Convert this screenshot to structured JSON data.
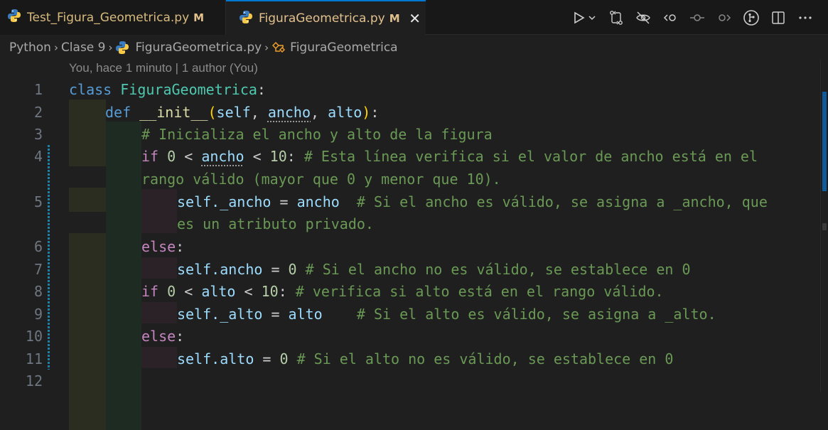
{
  "tabs": [
    {
      "label": "Test_Figura_Geometrica.py",
      "status": "M"
    },
    {
      "label": "FiguraGeometrica.py",
      "status": "M",
      "close": "✕"
    }
  ],
  "breadcrumb": {
    "items": [
      "Python",
      "Clase 9",
      "FiguraGeometrica.py",
      "FiguraGeometrica"
    ],
    "separator": "›"
  },
  "blame": "You, hace 1 minuto | 1 author (You)",
  "line_numbers": [
    "1",
    "2",
    "3",
    "4",
    "",
    "5",
    "",
    "6",
    "7",
    "8",
    "9",
    "10",
    "11",
    "12"
  ],
  "code": {
    "l1": {
      "kw": "class",
      "name": "FiguraGeometrica",
      "colon": ":"
    },
    "l2": {
      "kw": "def",
      "name": "__init__",
      "open": "(",
      "p1": "self",
      "c1": ", ",
      "p2": "ancho",
      "c2": ", ",
      "p3": "alto",
      "close": ")",
      "colon": ":"
    },
    "l3": {
      "comment": "# Inicializa el ancho y alto de la figura"
    },
    "l4": {
      "kw": "if",
      "n1": "0",
      "op1": " < ",
      "v": "ancho",
      "op2": " < ",
      "n2": "10",
      "colon": ": ",
      "comment": "# Esta línea verifica si el valor de ancho está en el"
    },
    "l4b": {
      "comment": "rango válido (mayor que 0 y menor que 10)."
    },
    "l5": {
      "self": "self",
      "attr": "._ancho",
      "eq": " = ",
      "v": "ancho",
      "sp": "  ",
      "comment": "# Si el ancho es válido, se asigna a _ancho, que"
    },
    "l5b": {
      "comment": "es un atributo privado."
    },
    "l6": {
      "kw": "else",
      "colon": ":"
    },
    "l7": {
      "self": "self",
      "attr": ".ancho",
      "eq": " = ",
      "n": "0",
      "comment": " # Si el ancho no es válido, se establece en 0"
    },
    "l8": {
      "kw": "if",
      "n1": "0",
      "op1": " < ",
      "v": "alto",
      "op2": " < ",
      "n2": "10",
      "colon": ": ",
      "comment": "# verifica si alto está en el rango válido."
    },
    "l9": {
      "self": "self",
      "attr": "._alto",
      "eq": " = ",
      "v": "alto",
      "sp": "    ",
      "comment": "# Si el alto es válido, se asigna a _alto."
    },
    "l10": {
      "kw": "else",
      "colon": ":"
    },
    "l11": {
      "self": "self",
      "attr": ".alto",
      "eq": " = ",
      "n": "0",
      "comment": " # Si el alto no es válido, se establece en 0"
    }
  },
  "colors": {
    "accent": "#0078d4",
    "modified": "#e2c08d",
    "keyword": "#569cd6",
    "control": "#c586c0",
    "class": "#4ec9b0",
    "comment": "#6a9955"
  }
}
